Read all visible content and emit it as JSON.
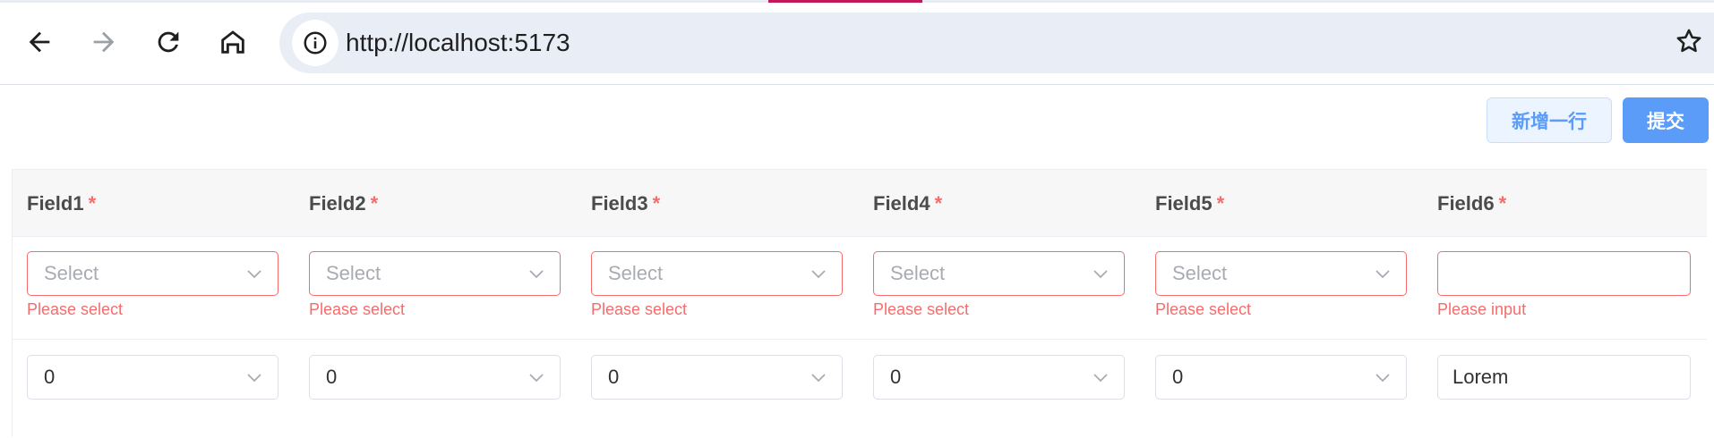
{
  "browser": {
    "url": "http://localhost:5173",
    "accent_color": "#c2185b",
    "icons": [
      "back-arrow-icon",
      "forward-arrow-icon",
      "reload-icon",
      "home-icon",
      "site-info-icon",
      "bookmark-star-icon"
    ]
  },
  "toolbar": {
    "add_row_label": "新增一行",
    "submit_label": "提交"
  },
  "table": {
    "columns": [
      {
        "label": "Field1",
        "required": "*"
      },
      {
        "label": "Field2",
        "required": "*"
      },
      {
        "label": "Field3",
        "required": "*"
      },
      {
        "label": "Field4",
        "required": "*"
      },
      {
        "label": "Field5",
        "required": "*"
      },
      {
        "label": "Field6",
        "required": "*"
      }
    ],
    "rows": [
      {
        "cells": [
          {
            "type": "select",
            "placeholder": "Select",
            "value": "",
            "error": "Please select"
          },
          {
            "type": "select",
            "placeholder": "Select",
            "value": "",
            "error": "Please select"
          },
          {
            "type": "select",
            "placeholder": "Select",
            "value": "",
            "error": "Please select"
          },
          {
            "type": "select",
            "placeholder": "Select",
            "value": "",
            "error": "Please select"
          },
          {
            "type": "select",
            "placeholder": "Select",
            "value": "",
            "error": "Please select"
          },
          {
            "type": "input",
            "placeholder": "",
            "value": "",
            "error": "Please input"
          }
        ]
      },
      {
        "cells": [
          {
            "type": "select",
            "value": "0"
          },
          {
            "type": "select",
            "value": "0"
          },
          {
            "type": "select",
            "value": "0"
          },
          {
            "type": "select",
            "value": "0"
          },
          {
            "type": "select",
            "value": "0"
          },
          {
            "type": "input",
            "value": "Lorem"
          }
        ]
      }
    ]
  },
  "colors": {
    "primary": "#5a9cf8",
    "danger": "#f56c6c",
    "header_bg": "#f7f7f7"
  }
}
